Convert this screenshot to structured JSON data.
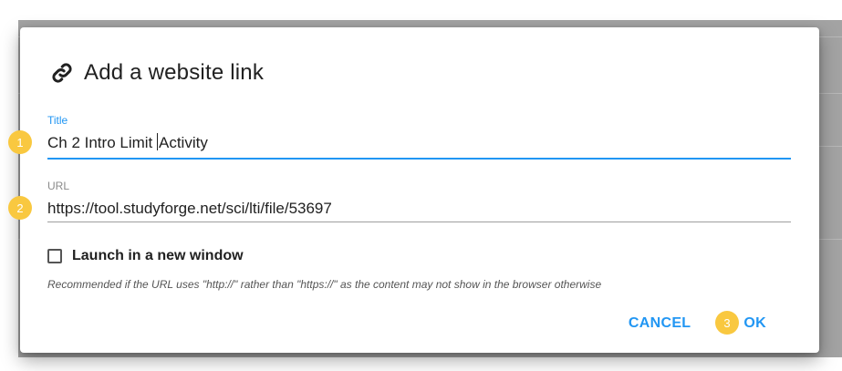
{
  "dialog": {
    "title": "Add a website link",
    "title_icon": "link-icon",
    "title_field": {
      "label": "Title",
      "value_before_caret": "Ch 2 Intro Limit ",
      "value_after_caret": "Activity"
    },
    "url_field": {
      "label": "URL",
      "value": "https://tool.studyforge.net/sci/lti/file/53697"
    },
    "new_window": {
      "label": "Launch in a new window",
      "checked": false
    },
    "hint": "Recommended if the URL uses \"http://\" rather than \"https://\" as the content may not show in the browser otherwise",
    "buttons": {
      "cancel": "CANCEL",
      "ok": "OK"
    }
  },
  "markers": [
    "1",
    "2",
    "3"
  ],
  "colors": {
    "accent": "#2196f3",
    "marker": "#f9c840"
  }
}
